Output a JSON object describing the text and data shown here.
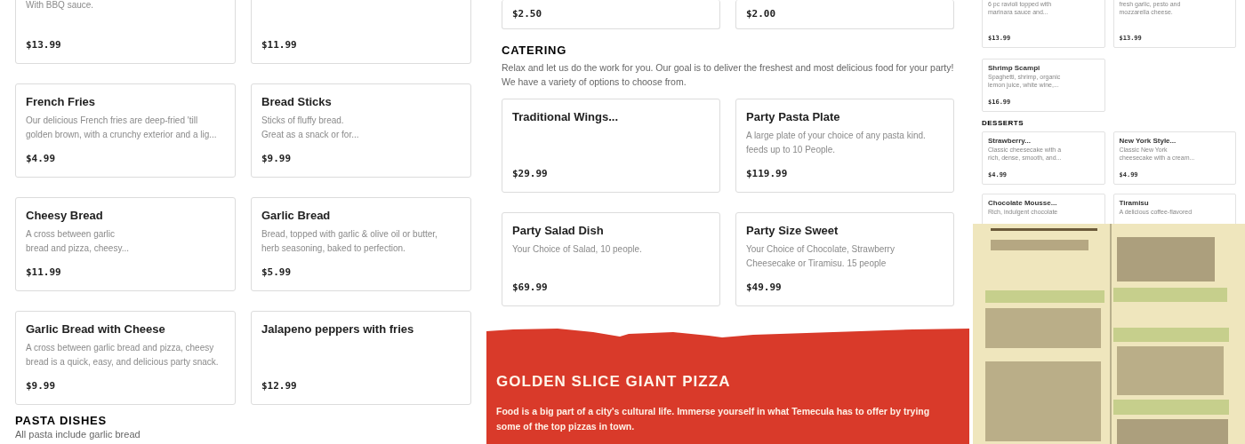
{
  "appetizers": {
    "cards": [
      {
        "description": "With BBQ sauce.",
        "price": "$13.99"
      },
      {
        "price": "$11.99"
      },
      {
        "title": "French Fries",
        "description": "Our delicious French fries are deep-fried 'till\ngolden brown, with a crunchy exterior and a lig...",
        "price": "$4.99"
      },
      {
        "title": "Bread Sticks",
        "description": "Sticks of fluffy bread.\nGreat as a snack or for...",
        "price": "$9.99"
      },
      {
        "title": "Cheesy Bread",
        "description": "A cross between garlic\nbread and pizza, cheesy...",
        "price": "$11.99"
      },
      {
        "title": "Garlic Bread",
        "description": "Bread, topped with garlic & olive oil or butter,\nherb seasoning, baked to perfection.",
        "price": "$5.99"
      },
      {
        "title": "Garlic Bread with Cheese",
        "description": "A cross between garlic bread and pizza, cheesy\nbread is a quick, easy, and delicious party snack.",
        "price": "$9.99"
      },
      {
        "title": "Jalapeno peppers with fries",
        "price": "$12.99"
      }
    ],
    "next_section": {
      "heading": "PASTA DISHES",
      "description": "All pasta include garlic bread"
    }
  },
  "extras": {
    "cards": [
      {
        "price": "$2.50"
      },
      {
        "price": "$2.00"
      }
    ]
  },
  "catering": {
    "heading": "CATERING",
    "description": "Relax and let us do the work for you. Our goal is to deliver the freshest and most delicious food for your party!\nWe have a variety of options to choose from.",
    "cards": [
      {
        "title": "Traditional Wings...",
        "price": "$29.99"
      },
      {
        "title": "Party Pasta Plate",
        "description": "A large plate of your choice of any pasta kind.\nfeeds up to 10 People.",
        "price": "$119.99"
      },
      {
        "title": "Party Salad Dish",
        "description": "Your Choice of Salad, 10 people.",
        "price": "$69.99"
      },
      {
        "title": "Party Size Sweet",
        "description": "Your Choice of Chocolate, Strawberry\nCheesecake or Tiramisu. 15 people",
        "price": "$49.99"
      }
    ]
  },
  "banner": {
    "heading": "GOLDEN SLICE GIANT PIZZA",
    "text": "Food is a big part of a city's cultural life. Immerse yourself in what Temecula has to offer by trying\nsome of the top pizzas in town."
  },
  "preview": {
    "pasta_cards": [
      {
        "description": "6 pc ravioli topped with\nmarinara sauce and...",
        "price": "$13.99"
      },
      {
        "description": "fresh garlic, pesto and\nmozzarella cheese.",
        "price": "$13.99"
      },
      {
        "title": "Shrimp Scampi",
        "description": "Spaghetti, shrimp, organic\nlemon juice, white wine,...",
        "price": "$16.99"
      }
    ],
    "desserts_heading": "DESSERTS",
    "dessert_cards": [
      {
        "title": "Strawberry...",
        "description": "Classic cheesecake with a\nrich, dense, smooth, and...",
        "price": "$4.99"
      },
      {
        "title": "New York Style...",
        "description": "Classic New York\ncheesecake with a cream...",
        "price": "$4.99"
      },
      {
        "title": "Chocolate Mousse...",
        "description": "Rich, indulgent chocolate"
      },
      {
        "title": "Tiramisu",
        "description": "A delicious coffee-flavored"
      }
    ]
  }
}
